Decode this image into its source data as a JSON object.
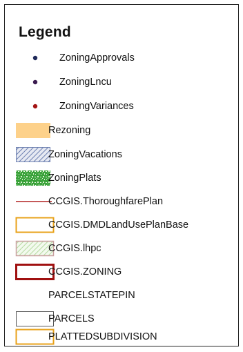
{
  "legend": {
    "title": "Legend",
    "items": [
      {
        "label": "ZoningApprovals",
        "icon": "navy-dot-icon",
        "color": "#1f2a5a"
      },
      {
        "label": "ZoningLncu",
        "icon": "purple-dot-icon",
        "color": "#3a1b4f"
      },
      {
        "label": "ZoningVariances",
        "icon": "red-dot-icon",
        "color": "#a31414"
      },
      {
        "label": "Rezoning",
        "icon": "orange-fill-swatch-icon",
        "color": "#fdd18a"
      },
      {
        "label": "ZoningVacations",
        "icon": "blue-hatch-swatch-icon",
        "color": "#6c7fb0"
      },
      {
        "label": "ZoningPlats",
        "icon": "green-pattern-swatch-icon",
        "color": "#3aa23a"
      },
      {
        "label": "CCGIS.ThoroughfarePlan",
        "icon": "red-line-icon",
        "color": "#b22222"
      },
      {
        "label": "CCGIS.DMDLandUsePlanBase",
        "icon": "orange-outline-swatch-icon",
        "color": "#e8a21a"
      },
      {
        "label": "CCGIS.lhpc",
        "icon": "green-hatch-swatch-icon",
        "color": "#b5d9a0"
      },
      {
        "label": "CCGIS.ZONING",
        "icon": "darkred-outline-swatch-icon",
        "color": "#a01010"
      },
      {
        "label": "PARCELSTATEPIN",
        "icon": "",
        "color": ""
      },
      {
        "label": "PARCELS",
        "icon": "gray-outline-swatch-icon",
        "color": "#555555"
      },
      {
        "label": "PLATTEDSUBDIVISION",
        "icon": "orange-outline-swatch-icon",
        "color": "#e8a21a"
      }
    ]
  }
}
